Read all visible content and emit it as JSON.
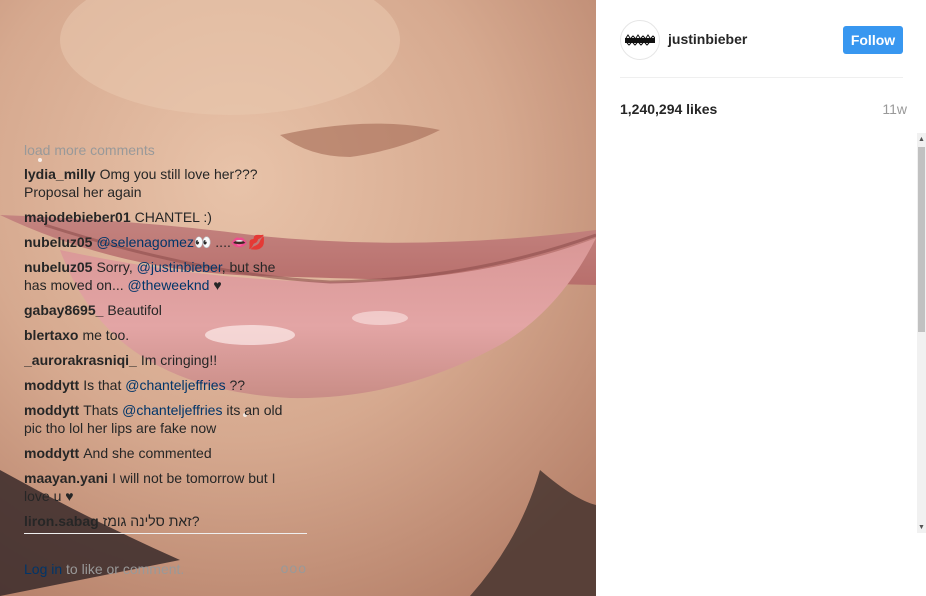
{
  "post": {
    "username": "justinbieber",
    "follow_label": "Follow",
    "likes": "1,240,294 likes",
    "age": "11w",
    "load_more": "load more comments",
    "comments": [
      {
        "user": "lydia_milly",
        "text": "Omg you still love her??? Proposal her again"
      },
      {
        "user": "majodebieber01",
        "text": "CHANTEL :)"
      },
      {
        "user": "nubeluz05",
        "mention": "@selenagomez",
        "after": "👀 ....👄💋"
      },
      {
        "user": "nubeluz05",
        "before": "Sorry, ",
        "mention": "@justinbieber",
        "middle": ", but she has moved on... ",
        "mention2": "@theweeknd",
        "after": " ♥"
      },
      {
        "user": "gabay8695_",
        "text": "Beautifol"
      },
      {
        "user": "blertaxo",
        "text": "me too."
      },
      {
        "user": "_aurorakrasniqi_",
        "text": "Im cringing!!"
      },
      {
        "user": "moddytt",
        "before": "Is that ",
        "mention": "@chanteljeffries",
        "after": " ??"
      },
      {
        "user": "moddytt",
        "before": "Thats ",
        "mention": "@chanteljeffries",
        "after": " its an old pic tho lol her lips are fake now"
      },
      {
        "user": "moddytt",
        "text": "And she commented"
      },
      {
        "user": "maayan.yani",
        "text": "I will not be tomorrow but I love u ♥"
      },
      {
        "user": "liron.sabag",
        "text": "זאת סלינה גומז?"
      }
    ],
    "login_link": "Log in",
    "login_rest": " to like or comment.",
    "more_icon": "ooo"
  },
  "colors": {
    "follow_button": "#3897f0",
    "mention": "#003569",
    "muted": "#999999"
  },
  "icons": [
    "purpose-tour-logo-icon",
    "more-options-icon",
    "scroll-up-icon",
    "scroll-down-icon"
  ]
}
